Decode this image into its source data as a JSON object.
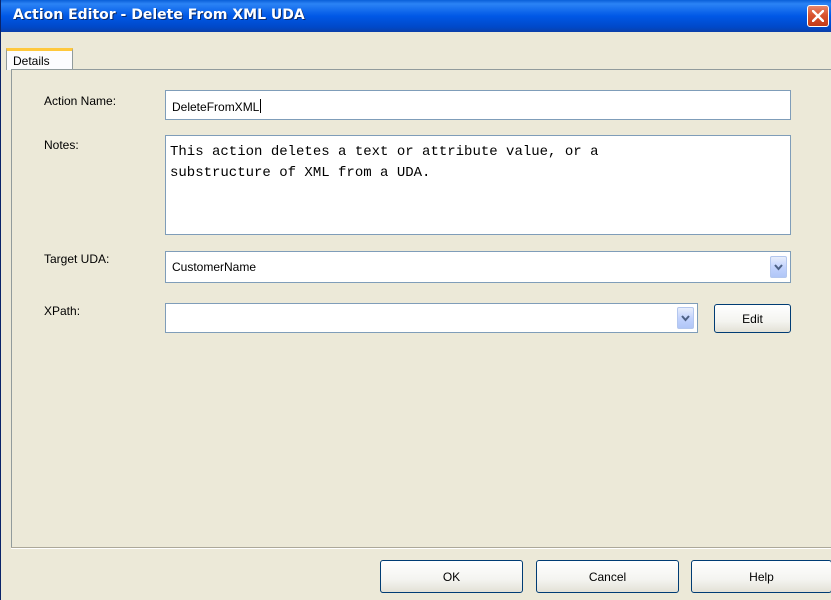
{
  "window": {
    "title": "Action Editor - Delete From XML UDA"
  },
  "tabs": [
    {
      "label": "Details",
      "selected": true
    }
  ],
  "form": {
    "action_name": {
      "label": "Action Name:",
      "value": "DeleteFromXML"
    },
    "notes": {
      "label": "Notes:",
      "value": "This action deletes a text or attribute value, or a\nsubstructure of XML from a UDA."
    },
    "target_uda": {
      "label": "Target UDA:",
      "value": "CustomerName"
    },
    "xpath": {
      "label": "XPath:",
      "value": "",
      "edit_label": "Edit"
    }
  },
  "buttons": {
    "ok": "OK",
    "cancel": "Cancel",
    "help": "Help"
  },
  "icons": {
    "close": "close-icon",
    "dropdown": "chevron-down-icon"
  },
  "colors": {
    "titlebar": "#0058e6",
    "close": "#d9542f",
    "tab_highlight": "#ffc83c",
    "dialog_bg": "#ece9d8"
  }
}
